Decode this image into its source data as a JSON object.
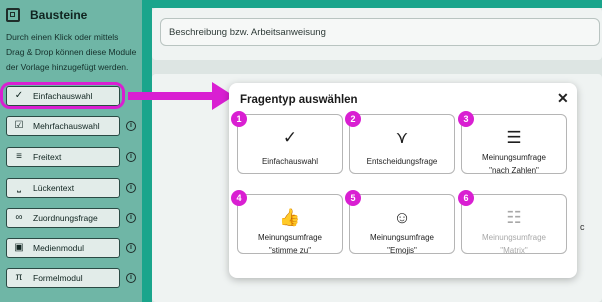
{
  "sidebar": {
    "title": "Bausteine",
    "description_lines": [
      "Durch einen Klick oder mittels",
      "Drag & Drop können diese Module",
      "der Vorlage hinzugefügt werden."
    ],
    "items": [
      {
        "label": "Einfachauswahl",
        "icon": "check-circle-icon"
      },
      {
        "label": "Mehrfachauswahl",
        "icon": "checkbox-icon"
      },
      {
        "label": "Freitext",
        "icon": "text-lines-icon"
      },
      {
        "label": "Lückentext",
        "icon": "blank-line-icon"
      },
      {
        "label": "Zuordnungsfrage",
        "icon": "link-icon"
      },
      {
        "label": "Medienmodul",
        "icon": "image-icon"
      },
      {
        "label": "Formelmodul",
        "icon": "pi-icon"
      }
    ],
    "info_icon": "i"
  },
  "main": {
    "description_placeholder": "Beschreibung bzw. Arbeitsanweisung",
    "edge_fragment": "c"
  },
  "modal": {
    "title": "Fragentyp auswählen",
    "close": "✕",
    "options": [
      {
        "num": "1",
        "line1": "Einfachauswahl",
        "line2": "",
        "icon": "check-circle-icon",
        "glyph": "✓"
      },
      {
        "num": "2",
        "line1": "Entscheidungsfrage",
        "line2": "",
        "icon": "split-arrow-icon",
        "glyph": "⋎"
      },
      {
        "num": "3",
        "line1": "Meinungsumfrage",
        "line2": "\"nach Zahlen\"",
        "icon": "numbered-list-icon",
        "glyph": "☰"
      },
      {
        "num": "4",
        "line1": "Meinungsumfrage",
        "line2": "\"stimme zu\"",
        "icon": "thumbs-up-icon",
        "glyph": "👍"
      },
      {
        "num": "5",
        "line1": "Meinungsumfrage",
        "line2": "\"Emojis\"",
        "icon": "smiley-icon",
        "glyph": "☺"
      },
      {
        "num": "6",
        "line1": "Meinungsumfrage",
        "line2": "\"Matrix\"",
        "icon": "sliders-icon",
        "glyph": "☷"
      }
    ]
  },
  "colors": {
    "accent": "#d91fd2",
    "brand": "#1aa58c",
    "sidebar": "#6fb6a6"
  }
}
